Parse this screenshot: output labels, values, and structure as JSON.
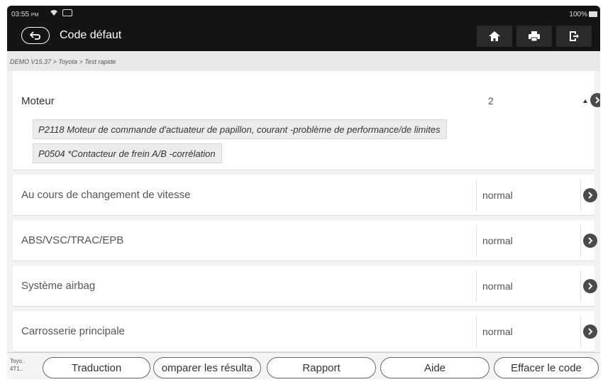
{
  "status_bar": {
    "time": "03:55",
    "ampm": "PM",
    "battery": "100%"
  },
  "header": {
    "title": "Code défaut",
    "toolbar": [
      "home-icon",
      "print-icon",
      "exit-icon"
    ]
  },
  "breadcrumb": "DEMO V15.37 > Toyota > Test rapide",
  "systems": [
    {
      "name": "Moteur",
      "value": "2",
      "codes": [
        "P2118 Moteur de commande d'actuateur de papillon, courant -problème de performance/de limites",
        "P0504 *Contacteur de frein A/B -corrélation"
      ]
    },
    {
      "name": "Au cours de changement de vitesse",
      "value": "normal"
    },
    {
      "name": "ABS/VSC/TRAC/EPB",
      "value": "normal"
    },
    {
      "name": "Système airbag",
      "value": "normal"
    },
    {
      "name": "Carrosserie principale",
      "value": "normal"
    }
  ],
  "footer": {
    "vehicle_line1": "Toyo..",
    "vehicle_line2": "4T1..",
    "buttons": [
      "Traduction",
      "omparer les résulta",
      "Rapport",
      "Aide",
      "Effacer le code"
    ]
  },
  "colors": {
    "header_bg": "#141414",
    "list_bg": "#f2f2f2",
    "arrow": "#4a4a4a"
  }
}
